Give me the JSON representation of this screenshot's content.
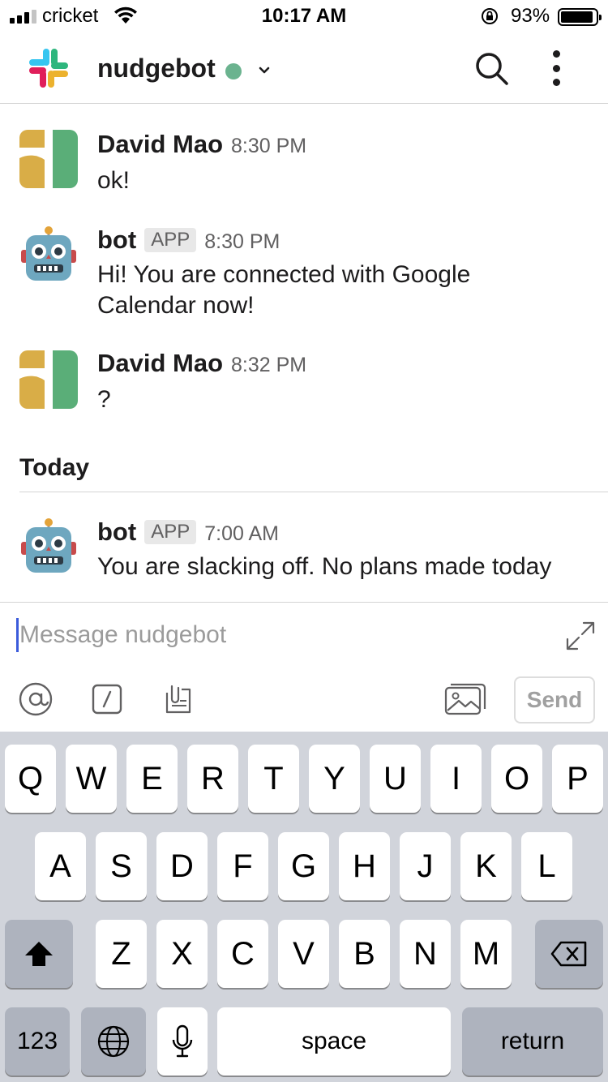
{
  "status_bar": {
    "carrier": "cricket",
    "time": "10:17 AM",
    "battery_percent": "93%",
    "battery_level": 0.93
  },
  "header": {
    "channel_name": "nudgebot",
    "presence_color": "#6bb38f"
  },
  "messages": [
    {
      "author": "David Mao",
      "badge": "",
      "time": "8:30 PM",
      "text": "ok!",
      "avatar": "user-avatar"
    },
    {
      "author": "bot",
      "badge": "APP",
      "time": "8:30 PM",
      "text": "Hi! You are connected with Google Calendar now!",
      "avatar": "robot-avatar"
    },
    {
      "author": "David Mao",
      "badge": "",
      "time": "8:32 PM",
      "text": "?",
      "avatar": "user-avatar"
    },
    {
      "author": "bot",
      "badge": "APP",
      "time": "7:00 AM",
      "text": "You are slacking off. No plans made today",
      "avatar": "robot-avatar"
    }
  ],
  "day_divider": "Today",
  "composer": {
    "placeholder": "Message nudgebot",
    "value": "",
    "send_label": "Send",
    "tools": [
      "at-icon",
      "slash-icon",
      "attachment-icon"
    ],
    "photo_tool": "image-icon"
  },
  "keyboard": {
    "row1": [
      "Q",
      "W",
      "E",
      "R",
      "T",
      "Y",
      "U",
      "I",
      "O",
      "P"
    ],
    "row2": [
      "A",
      "S",
      "D",
      "F",
      "G",
      "H",
      "J",
      "K",
      "L"
    ],
    "row3": [
      "Z",
      "X",
      "C",
      "V",
      "B",
      "N",
      "M"
    ],
    "numbers_label": "123",
    "space_label": "space",
    "return_label": "return",
    "shift_icon": "shift-icon",
    "backspace_icon": "backspace-icon",
    "globe_icon": "globe-icon",
    "mic_icon": "microphone-icon"
  },
  "colors": {
    "slack_blue": "#36c5f0",
    "slack_green": "#2eb67d",
    "slack_red": "#e01e5a",
    "slack_yellow": "#ecb22e",
    "cursor": "#3b5bdb",
    "keyboard_bg": "#d1d4db"
  }
}
